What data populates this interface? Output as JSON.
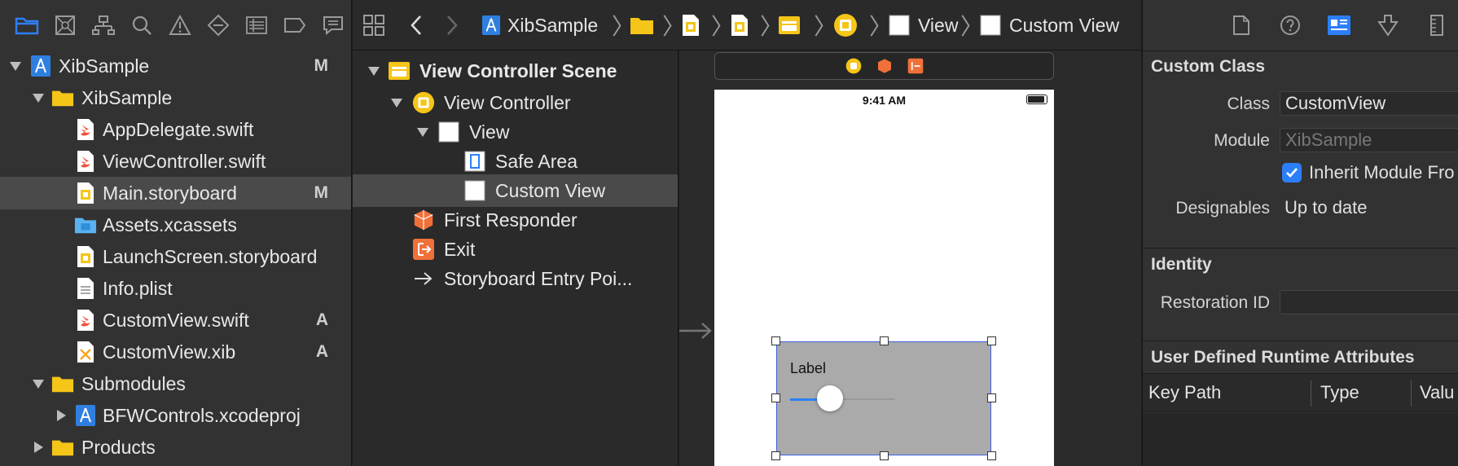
{
  "navigator": {
    "toolbar_icons": [
      "folder-icon",
      "source-control-icon",
      "symbol-icon",
      "search-icon",
      "warning-icon",
      "test-icon",
      "debug-icon",
      "breakpoint-icon",
      "report-icon"
    ],
    "tree": [
      {
        "label": "XibSample",
        "badge": "M"
      },
      {
        "label": "XibSample",
        "badge": ""
      },
      {
        "label": "AppDelegate.swift",
        "badge": ""
      },
      {
        "label": "ViewController.swift",
        "badge": ""
      },
      {
        "label": "Main.storyboard",
        "badge": "M"
      },
      {
        "label": "Assets.xcassets",
        "badge": ""
      },
      {
        "label": "LaunchScreen.storyboard",
        "badge": ""
      },
      {
        "label": "Info.plist",
        "badge": ""
      },
      {
        "label": "CustomView.swift",
        "badge": "A"
      },
      {
        "label": "CustomView.xib",
        "badge": "A"
      },
      {
        "label": "Submodules",
        "badge": ""
      },
      {
        "label": "BFWControls.xcodeproj",
        "badge": ""
      },
      {
        "label": "Products",
        "badge": ""
      }
    ]
  },
  "jumpbar": {
    "project": "XibSample",
    "view": "View",
    "custom_view": "Custom View"
  },
  "outline": {
    "items": [
      "View Controller Scene",
      "View Controller",
      "View",
      "Safe Area",
      "Custom View",
      "First Responder",
      "Exit",
      "Storyboard Entry Poi..."
    ]
  },
  "canvas": {
    "status_time": "9:41 AM",
    "custom_view_label": "Label",
    "slider_value": 0.38
  },
  "inspector": {
    "custom_class_title": "Custom Class",
    "class_label": "Class",
    "class_value": "CustomView",
    "module_label": "Module",
    "module_placeholder": "XibSample",
    "inherit_label": "Inherit Module Fro",
    "designables_label": "Designables",
    "designables_value": "Up to date",
    "identity_title": "Identity",
    "restoration_label": "Restoration ID",
    "udra_title": "User Defined Runtime Attributes",
    "col_keypath": "Key Path",
    "col_type": "Type",
    "col_value": "Valu"
  },
  "colors": {
    "accent": "#2d7ff9",
    "selection_border": "#3f5fe0",
    "storyboard_yellow": "#f5c518",
    "orange": "#f0703a"
  }
}
